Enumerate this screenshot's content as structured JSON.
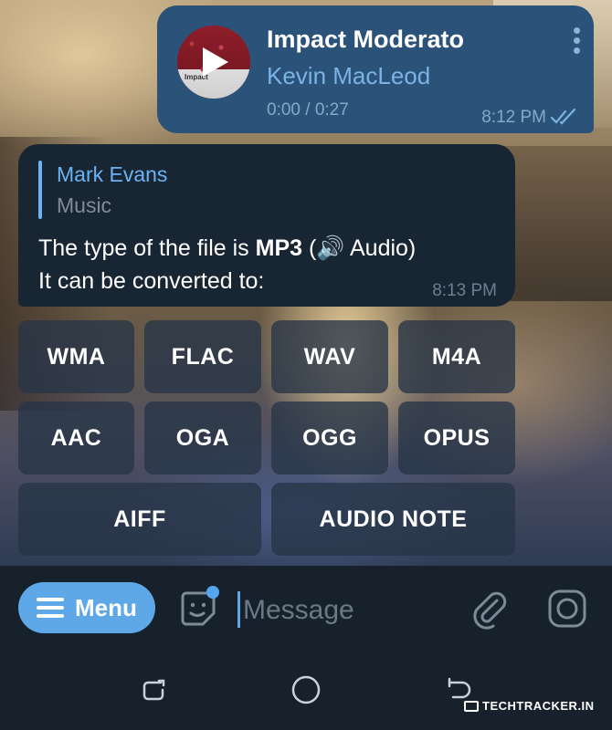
{
  "outgoing_audio": {
    "title": "Impact Moderato",
    "artist": "Kevin MacLeod",
    "progress": "0:00 / 0:27",
    "time": "8:12 PM",
    "cover_text": "Impact",
    "read_status": "double-check-icon"
  },
  "incoming_message": {
    "reply_name": "Mark Evans",
    "reply_text": "Music",
    "text_prefix": "The type of the file is ",
    "file_type": "MP3",
    "text_suffix": " (🔊 Audio)",
    "text_line2": "It can be converted to:",
    "time": "8:13 PM"
  },
  "keyboard": {
    "row1": [
      "WMA",
      "FLAC",
      "WAV",
      "M4A"
    ],
    "row2": [
      "AAC",
      "OGA",
      "OGG",
      "OPUS"
    ],
    "row3": [
      "AIFF",
      "AUDIO NOTE"
    ]
  },
  "input_bar": {
    "menu_label": "Menu",
    "placeholder": "Message"
  },
  "watermark": "TECHTRACKER.IN",
  "colors": {
    "outgoing_bubble": "#2b5278",
    "incoming_bubble": "#182533",
    "accent": "#5fa8e8",
    "link": "#6ab3f3"
  }
}
